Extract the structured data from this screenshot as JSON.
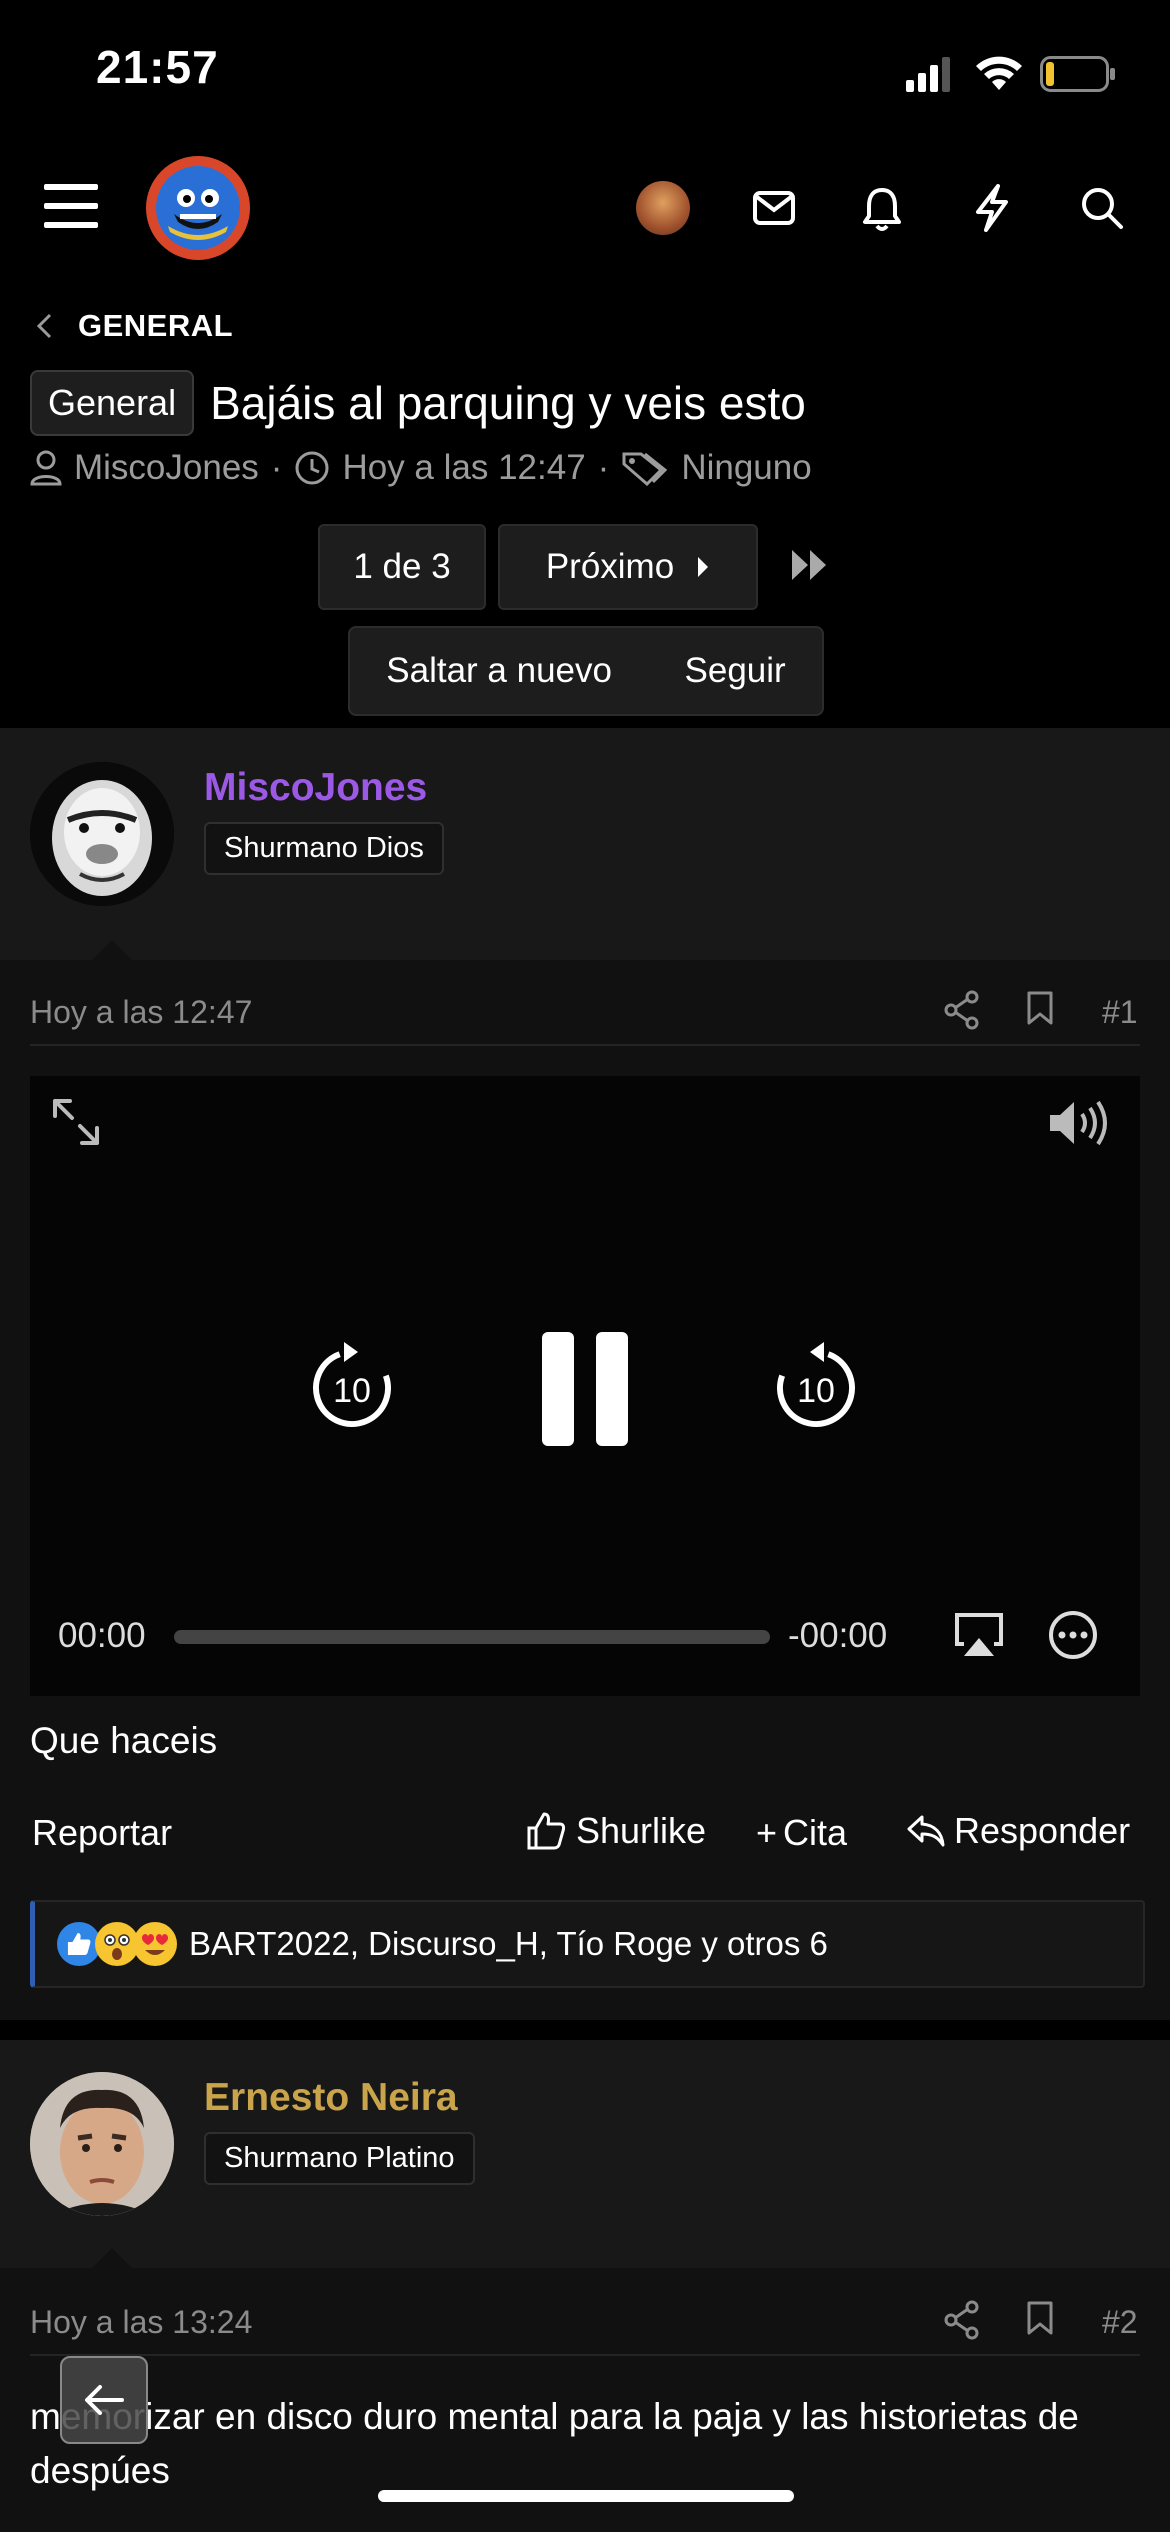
{
  "status_bar": {
    "time": "21:57"
  },
  "header": {
    "icons": [
      "menu-icon",
      "logo",
      "avatar",
      "mail-icon",
      "bell-icon",
      "lightning-icon",
      "search-icon"
    ]
  },
  "breadcrumb": {
    "label": "GENERAL"
  },
  "thread": {
    "prefix": "General",
    "title": "Bajáis al parquing y veis esto",
    "author": "MiscoJones",
    "time": "Hoy a las 12:47",
    "tags": "Ninguno",
    "separator": "·"
  },
  "pagination": {
    "page": "1 de 3",
    "next": "Próximo"
  },
  "thread_actions": {
    "jump_new": "Saltar a nuevo",
    "follow": "Seguir"
  },
  "posts": [
    {
      "username": "MiscoJones",
      "username_color": "#9b59e6",
      "user_title": "Shurmano Dios",
      "date": "Hoy a las 12:47",
      "number": "#1",
      "video": {
        "elapsed": "00:00",
        "remaining": "-00:00",
        "progress": 0
      },
      "content": "Que haceis",
      "actions": {
        "report": "Reportar",
        "like": "Shurlike",
        "quote": "Cita",
        "reply": "Responder",
        "quote_prefix": "+"
      },
      "reactions_text": "BART2022, Discurso_H, Tío Roge y otros 6"
    },
    {
      "username": "Ernesto Neira",
      "username_color": "#c9a44a",
      "user_title": "Shurmano Platino",
      "date": "Hoy a las 13:24",
      "number": "#2",
      "content": "memorizar en disco duro mental para la paja y las historietas de despúes"
    }
  ]
}
